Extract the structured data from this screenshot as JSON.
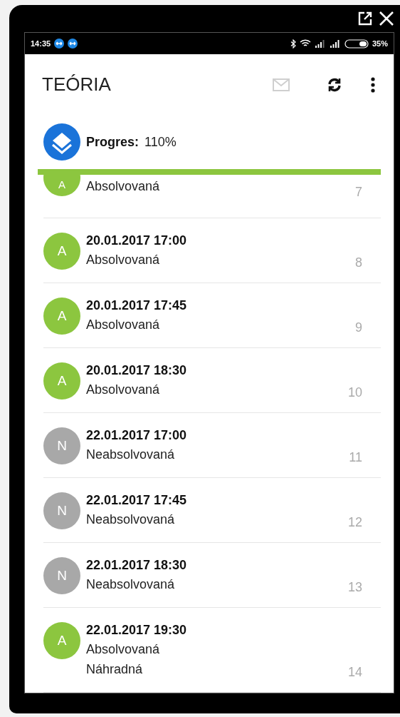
{
  "status_bar": {
    "time": "14:35",
    "battery": "35%"
  },
  "app_bar": {
    "title": "TEÓRIA",
    "mail_disabled": true
  },
  "progress": {
    "label": "Progres:",
    "value": "110%",
    "level": 1
  },
  "items": [
    {
      "avatar": "A",
      "color": "#8cc63f",
      "status": "Absolvovaná",
      "number": "7"
    },
    {
      "avatar": "A",
      "color": "#8cc63f",
      "date": "20.01.2017 17:00",
      "status": "Absolvovaná",
      "number": "8"
    },
    {
      "avatar": "A",
      "color": "#8cc63f",
      "date": "20.01.2017 17:45",
      "status": "Absolvovaná",
      "number": "9"
    },
    {
      "avatar": "A",
      "color": "#8cc63f",
      "date": "20.01.2017 18:30",
      "status": "Absolvovaná",
      "number": "10"
    },
    {
      "avatar": "N",
      "color": "#a8a8a8",
      "date": "22.01.2017 17:00",
      "status": "Neabsolvovaná",
      "number": "11"
    },
    {
      "avatar": "N",
      "color": "#a8a8a8",
      "date": "22.01.2017 17:45",
      "status": "Neabsolvovaná",
      "number": "12"
    },
    {
      "avatar": "N",
      "color": "#a8a8a8",
      "date": "22.01.2017 18:30",
      "status": "Neabsolvovaná",
      "number": "13"
    },
    {
      "avatar": "A",
      "color": "#8cc63f",
      "date": "22.01.2017 19:30",
      "status": "Absolvovaná",
      "note": "Náhradná",
      "number": "14"
    }
  ]
}
